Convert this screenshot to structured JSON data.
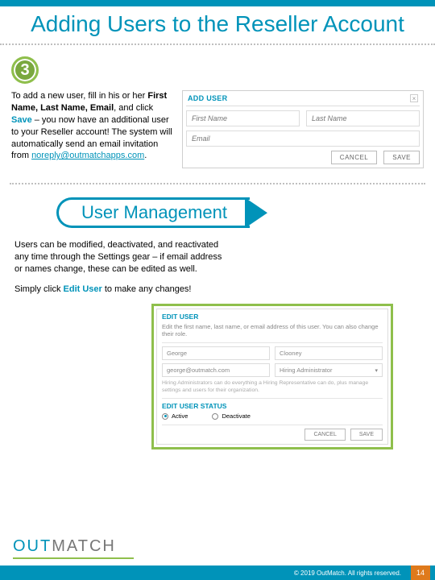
{
  "title": "Adding Users to the Reseller Account",
  "step_number": "3",
  "step_body": {
    "prefix": "To add a new user, fill in his or her ",
    "bold": "First Name, Last Name, Email",
    "mid1": ", and click ",
    "save_word": "Save",
    "mid2": " – you now have an additional user to your Reseller account! The system will automatically send an email invitation from ",
    "email_link": "noreply@outmatchapps.com",
    "suffix": "."
  },
  "add_user": {
    "title": "ADD USER",
    "first_placeholder": "First Name",
    "last_placeholder": "Last Name",
    "email_placeholder": "Email",
    "cancel": "CANCEL",
    "save": "SAVE"
  },
  "ribbon": "User Management",
  "mgmt_para1": "Users can be modified, deactivated, and reactivated any time through the Settings gear – if email address or names change, these can be edited as well.",
  "mgmt_para2_a": "Simply click ",
  "mgmt_para2_b": "Edit User",
  "mgmt_para2_c": " to make any changes!",
  "edit_user": {
    "title": "EDIT USER",
    "desc": "Edit the first name, last name, or email address of this user. You can also change their role.",
    "first": "George",
    "last": "Clooney",
    "email": "george@outmatch.com",
    "role": "Hiring Administrator",
    "hint": "Hiring Administrators can do everything a Hiring Representative can do, plus manage settings and users for their organization.",
    "status_title": "EDIT USER STATUS",
    "active": "Active",
    "deactivate": "Deactivate",
    "cancel": "CANCEL",
    "save": "SAVE"
  },
  "logo_a": "OUT",
  "logo_b": "MATCH",
  "copyright": "© 2019 OutMatch. All rights reserved.",
  "page": "14"
}
